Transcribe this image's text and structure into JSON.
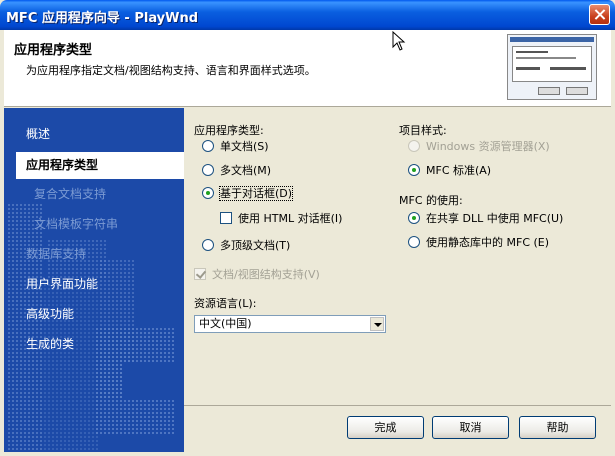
{
  "window": {
    "title": "MFC 应用程序向导 - PlayWnd"
  },
  "header": {
    "title": "应用程序类型",
    "subtitle": "为应用程序指定文档/视图结构支持、语言和界面样式选项。"
  },
  "sidebar": {
    "items": [
      {
        "label": "概述",
        "state": "normal"
      },
      {
        "label": "应用程序类型",
        "state": "selected"
      },
      {
        "label": "复合文档支持",
        "state": "disabled"
      },
      {
        "label": "文档模板字符串",
        "state": "disabled"
      },
      {
        "label": "数据库支持",
        "state": "disabled"
      },
      {
        "label": "用户界面功能",
        "state": "normal"
      },
      {
        "label": "高级功能",
        "state": "normal"
      },
      {
        "label": "生成的类",
        "state": "normal"
      }
    ]
  },
  "app_type": {
    "label": "应用程序类型:",
    "options": {
      "single": "单文档(S)",
      "multi": "多文档(M)",
      "dialog": "基于对话框(D)",
      "html_dialog": "使用 HTML 对话框(I)",
      "multi_top": "多顶级文档(T)"
    },
    "selected": "dialog"
  },
  "doc_view": {
    "label": "文档/视图结构支持(V)",
    "checked": true,
    "enabled": false
  },
  "resource_language": {
    "label": "资源语言(L):",
    "value": "中文(中国)"
  },
  "project_style": {
    "label": "项目样式:",
    "options": {
      "explorer": "Windows 资源管理器(X)",
      "mfc_standard": "MFC 标准(A)"
    },
    "selected": "mfc_standard"
  },
  "mfc_usage": {
    "label": "MFC 的使用:",
    "options": {
      "shared_dll": "在共享 DLL 中使用 MFC(U)",
      "static_lib": "使用静态库中的 MFC (E)"
    },
    "selected": "shared_dll"
  },
  "buttons": {
    "finish": "完成",
    "cancel": "取消",
    "help": "帮助"
  },
  "colors": {
    "titlebar": "#0a5fe0",
    "sidebar": "#1c4aa8",
    "face": "#ece9d8",
    "accent_radio": "#21a121"
  }
}
